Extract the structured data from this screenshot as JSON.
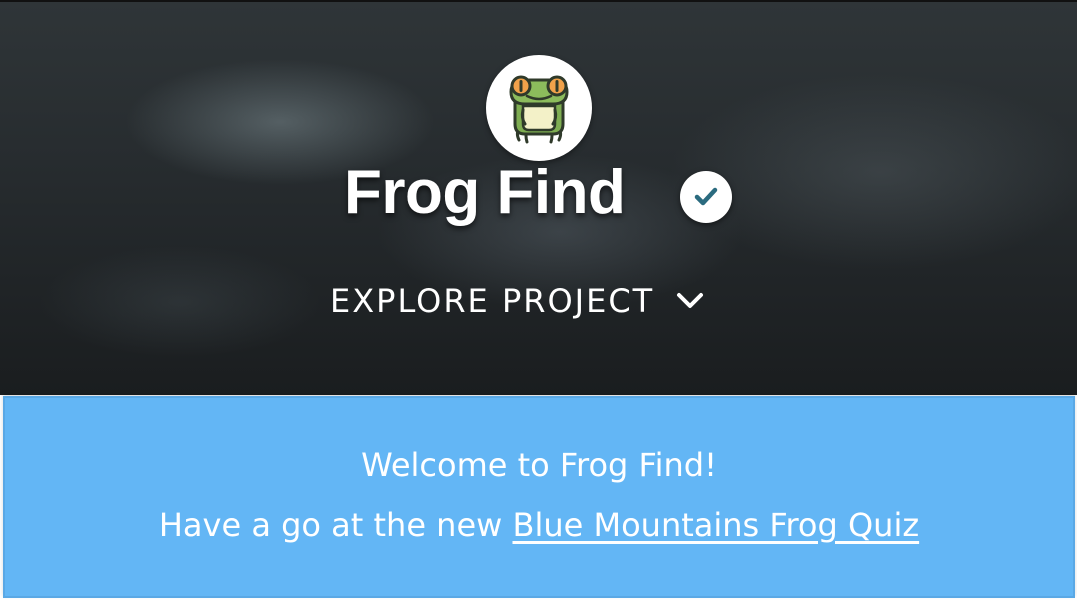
{
  "hero": {
    "logo_icon": "frog-icon",
    "title": "Frog Find",
    "verified_icon": "verified-check-icon",
    "explore_label": "EXPLORE PROJECT",
    "explore_icon": "chevron-down-icon"
  },
  "notice": {
    "welcome": "Welcome to Frog Find!",
    "prompt": "Have a go at the new",
    "link_text": "Blue Mountains Frog Quiz",
    "background_color": "#63b6f5"
  },
  "colors": {
    "accent": "#2b6b7f",
    "hero_dark": "#262b2e"
  }
}
